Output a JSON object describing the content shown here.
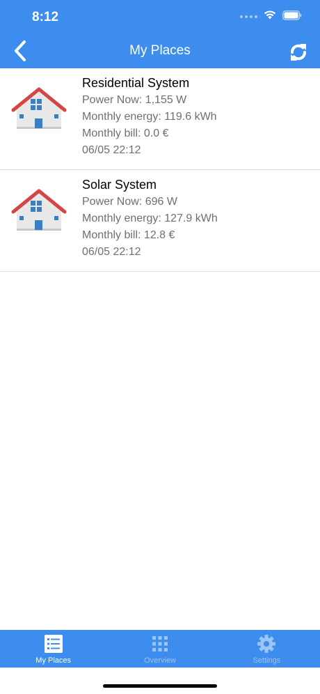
{
  "status_bar": {
    "time": "8:12"
  },
  "nav_bar": {
    "title": "My Places"
  },
  "places": [
    {
      "name": "Residential System",
      "power_now": "Power Now: 1,155 W",
      "monthly_energy": "Monthly energy: 119.6 kWh",
      "monthly_bill": "Monthly bill: 0.0 €",
      "timestamp": "06/05 22:12"
    },
    {
      "name": "Solar System",
      "power_now": "Power Now: 696 W",
      "monthly_energy": "Monthly energy: 127.9 kWh",
      "monthly_bill": "Monthly bill: 12.8 €",
      "timestamp": "06/05 22:12"
    }
  ],
  "tab_bar": {
    "tabs": [
      {
        "label": "My Places",
        "icon": "list-icon",
        "active": true
      },
      {
        "label": "Overview",
        "icon": "grid-icon",
        "active": false
      },
      {
        "label": "Settings",
        "icon": "gear-icon",
        "active": false
      }
    ]
  },
  "colors": {
    "brand": "#3c8dee",
    "tab_inactive": "#9cc5f5",
    "house_roof": "#d64545",
    "house_window": "#3a7fc1",
    "house_wall": "#e8e8e8"
  }
}
